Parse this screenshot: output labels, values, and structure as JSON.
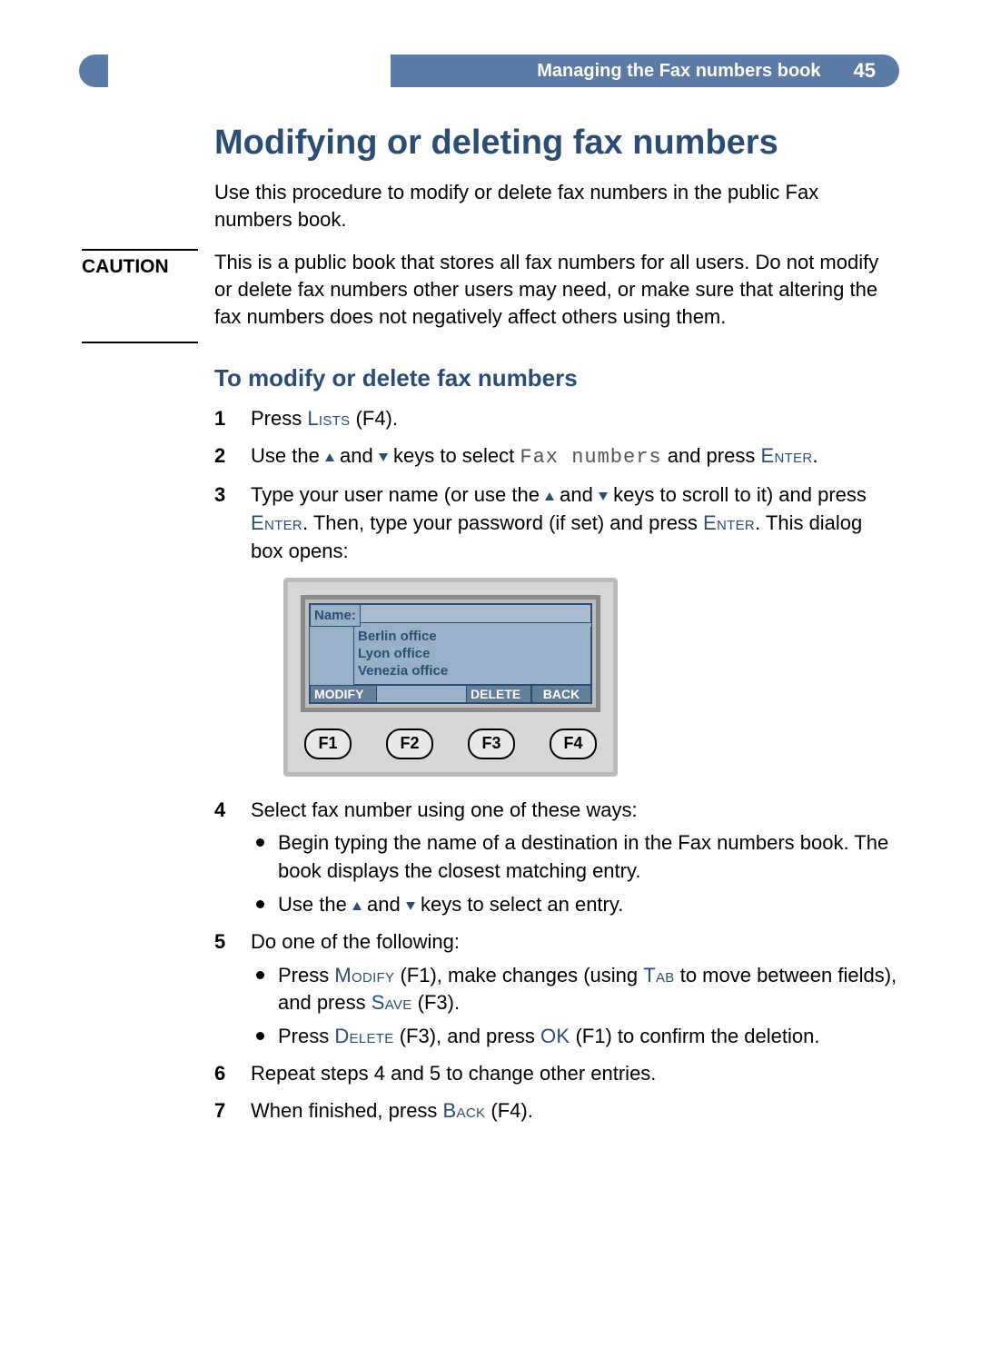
{
  "header": {
    "section": "Managing the Fax numbers book",
    "page_number": "45"
  },
  "title": "Modifying or deleting fax numbers",
  "intro": "Use this procedure to modify or delete fax numbers in the public Fax numbers book.",
  "caution": {
    "label": "CAUTION",
    "text": "This is a public book that stores all fax numbers for all users. Do not modify or delete fax numbers other users may need, or make sure that altering the fax numbers does not negatively affect others using them."
  },
  "subhead": "To modify or delete fax numbers",
  "steps": {
    "s1": {
      "num": "1",
      "a": "Press ",
      "key1": "Lists",
      "b": " (F4)."
    },
    "s2": {
      "num": "2",
      "a": "Use the ",
      "b": " and ",
      "c": " keys to select ",
      "tt": "Fax numbers",
      "d": " and press ",
      "key1": "Enter",
      "e": "."
    },
    "s3": {
      "num": "3",
      "a": "Type your user name (or use the ",
      "b": " and ",
      "c": " keys to scroll to it) and press ",
      "key1": "Enter",
      "d": ". Then, type your password (if set) and press ",
      "key2": "Enter",
      "e": ". This dialog box opens:"
    },
    "s4": {
      "num": "4",
      "a": "Select fax number using one of these ways:",
      "b1": "Begin typing the name of a destination in the Fax numbers book. The book displays the closest matching entry.",
      "b2a": "Use the ",
      "b2b": " and ",
      "b2c": " keys to select an entry."
    },
    "s5": {
      "num": "5",
      "a": "Do one of the following:",
      "b1a": "Press ",
      "b1key1": "Modify",
      "b1b": " (F1), make changes (using ",
      "b1key2": "Tab",
      "b1c": " to move between fields), and press ",
      "b1key3": "Save",
      "b1d": " (F3).",
      "b2a": "Press ",
      "b2key1": "Delete",
      "b2b": " (F3), and press ",
      "b2key2": "OK",
      "b2c": " (F1) to confirm the deletion."
    },
    "s6": {
      "num": "6",
      "a": "Repeat steps 4 and 5 to change other entries."
    },
    "s7": {
      "num": "7",
      "a": "When finished, press ",
      "key1": "Back",
      "b": " (F4)."
    }
  },
  "dialog": {
    "name_label": "Name:",
    "items": {
      "0": "Berlin office",
      "1": "Lyon office",
      "2": "Venezia office"
    },
    "softkeys": {
      "modify": "MODIFY",
      "delete": "DELETE",
      "back": "BACK"
    },
    "fkeys": {
      "0": "F1",
      "1": "F2",
      "2": "F3",
      "3": "F4"
    }
  }
}
